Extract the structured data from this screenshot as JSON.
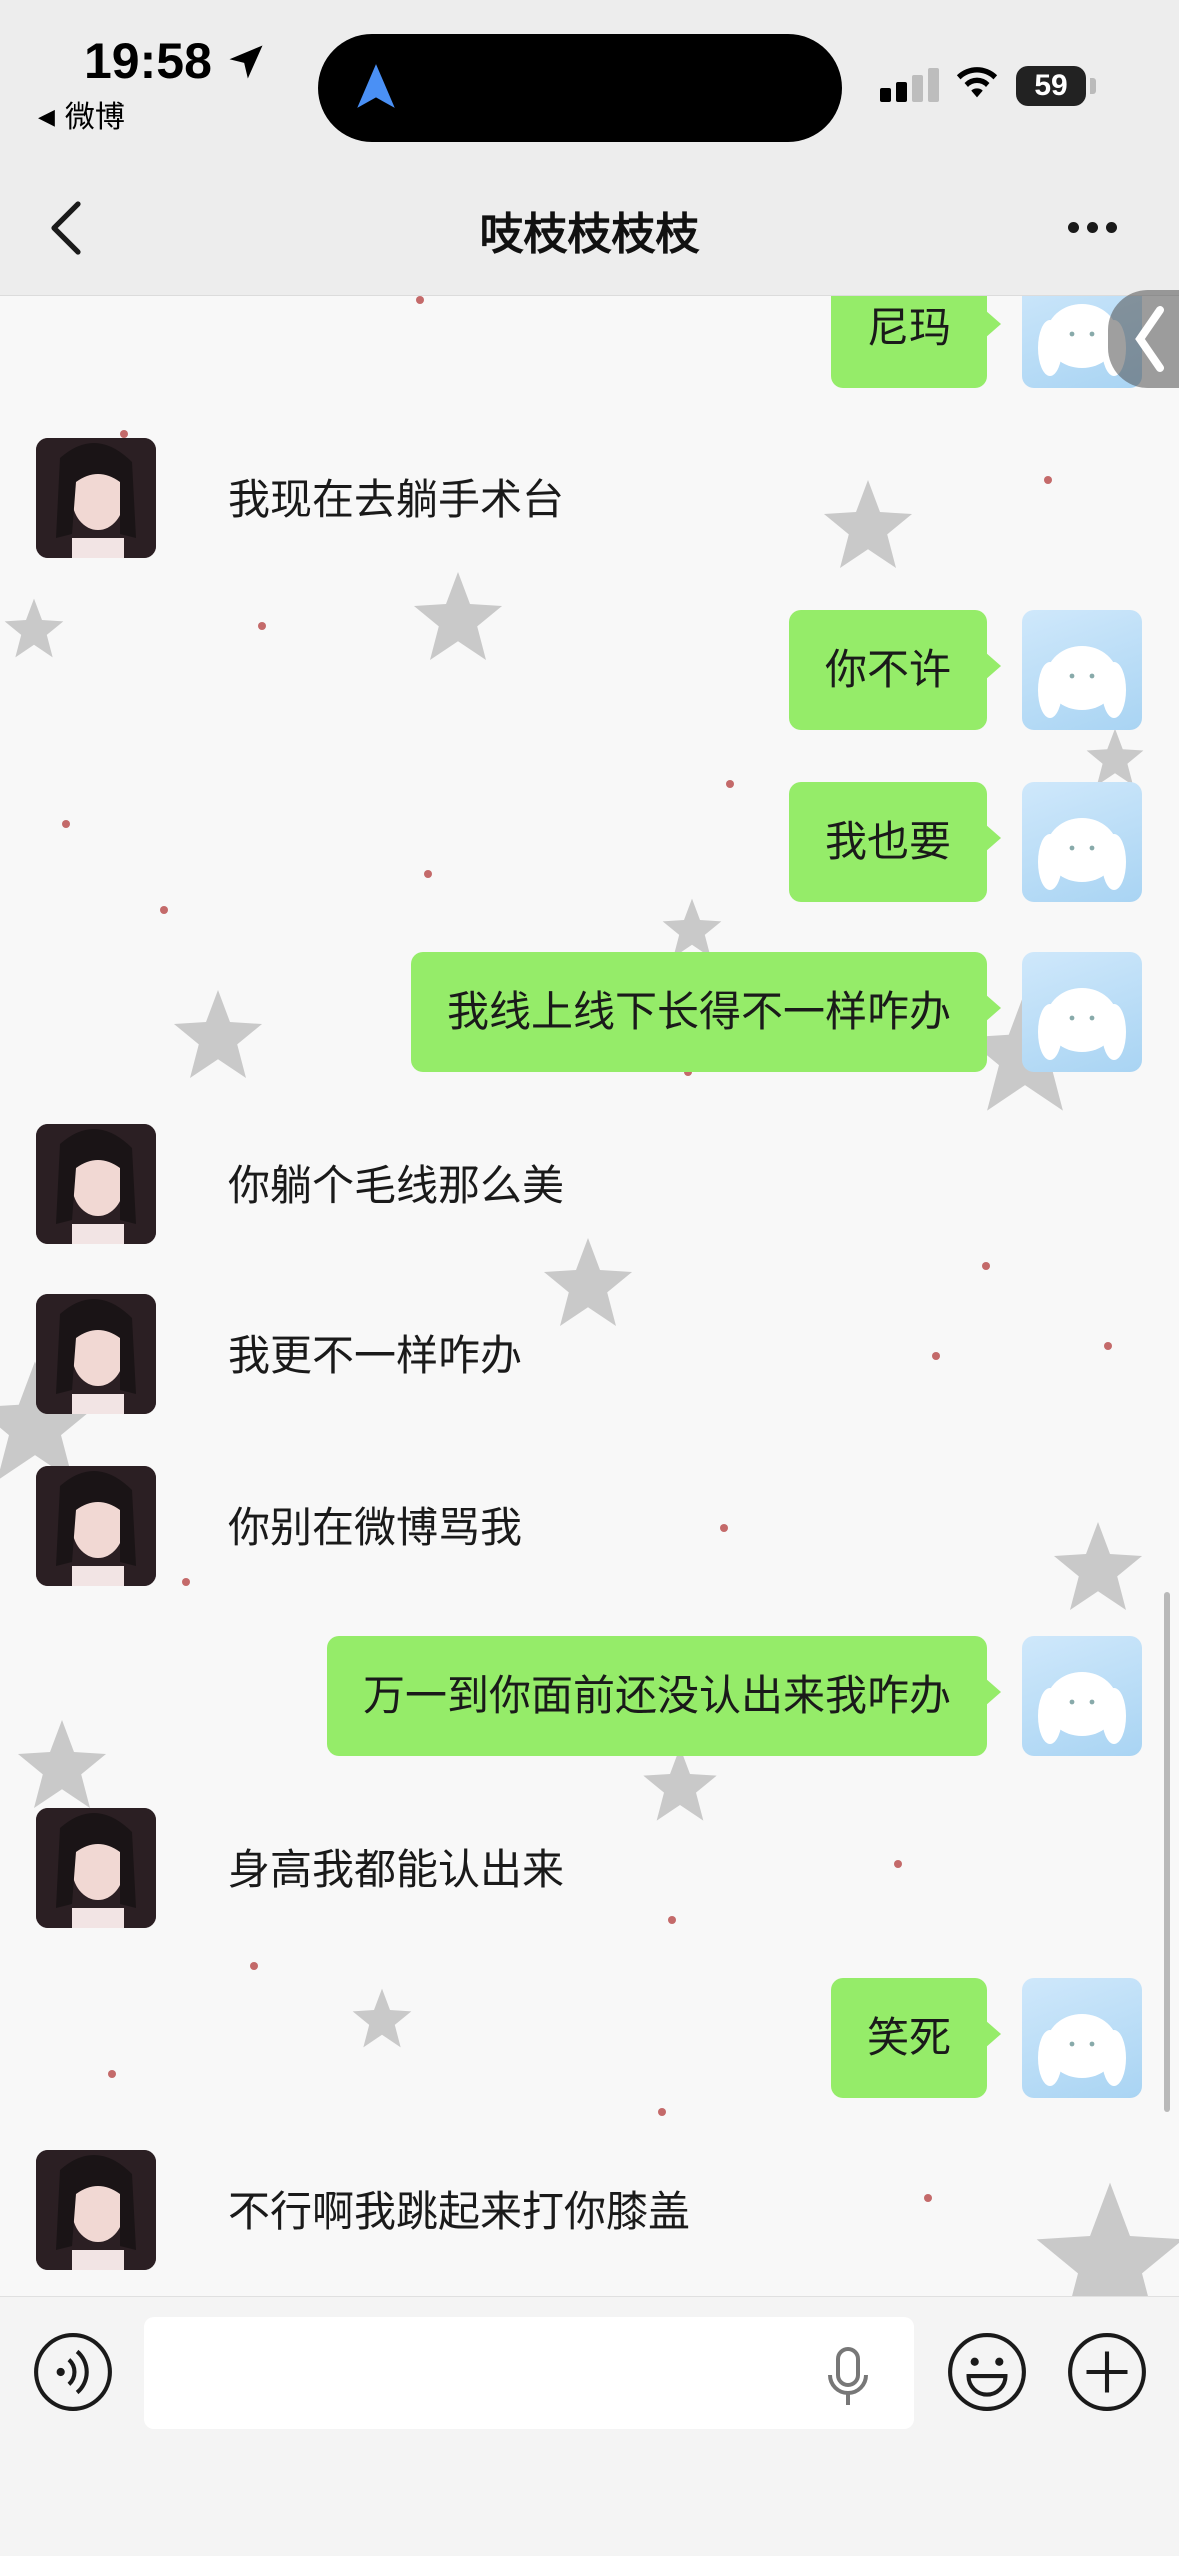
{
  "status_bar": {
    "time": "19:58",
    "back_app": "微博",
    "battery": "59"
  },
  "header": {
    "title": "吱枝枝枝枝"
  },
  "messages": [
    {
      "from": "me",
      "text": "尼玛"
    },
    {
      "from": "other",
      "text": "我现在去躺手术台"
    },
    {
      "from": "me",
      "text": "你不许"
    },
    {
      "from": "me",
      "text": "我也要"
    },
    {
      "from": "me",
      "text": "我线上线下长得不一样咋办"
    },
    {
      "from": "other",
      "text": "你躺个毛线那么美"
    },
    {
      "from": "other",
      "text": "我更不一样咋办"
    },
    {
      "from": "other",
      "text": "你别在微博骂我"
    },
    {
      "from": "me",
      "text": "万一到你面前还没认出来我咋办"
    },
    {
      "from": "other",
      "text": "身高我都能认出来"
    },
    {
      "from": "me",
      "text": "笑死"
    },
    {
      "from": "other",
      "text": "不行啊我跳起来打你膝盖"
    }
  ],
  "input": {
    "value": "",
    "placeholder": ""
  },
  "colors": {
    "bubble_out": "#95ec69",
    "header_bg": "#ededed"
  },
  "icons": [
    "location-arrow-icon",
    "navigation-icon",
    "signal-icon",
    "wifi-icon",
    "back-chevron-icon",
    "more-icon",
    "voice-icon",
    "microphone-icon",
    "emoji-icon",
    "plus-icon"
  ]
}
